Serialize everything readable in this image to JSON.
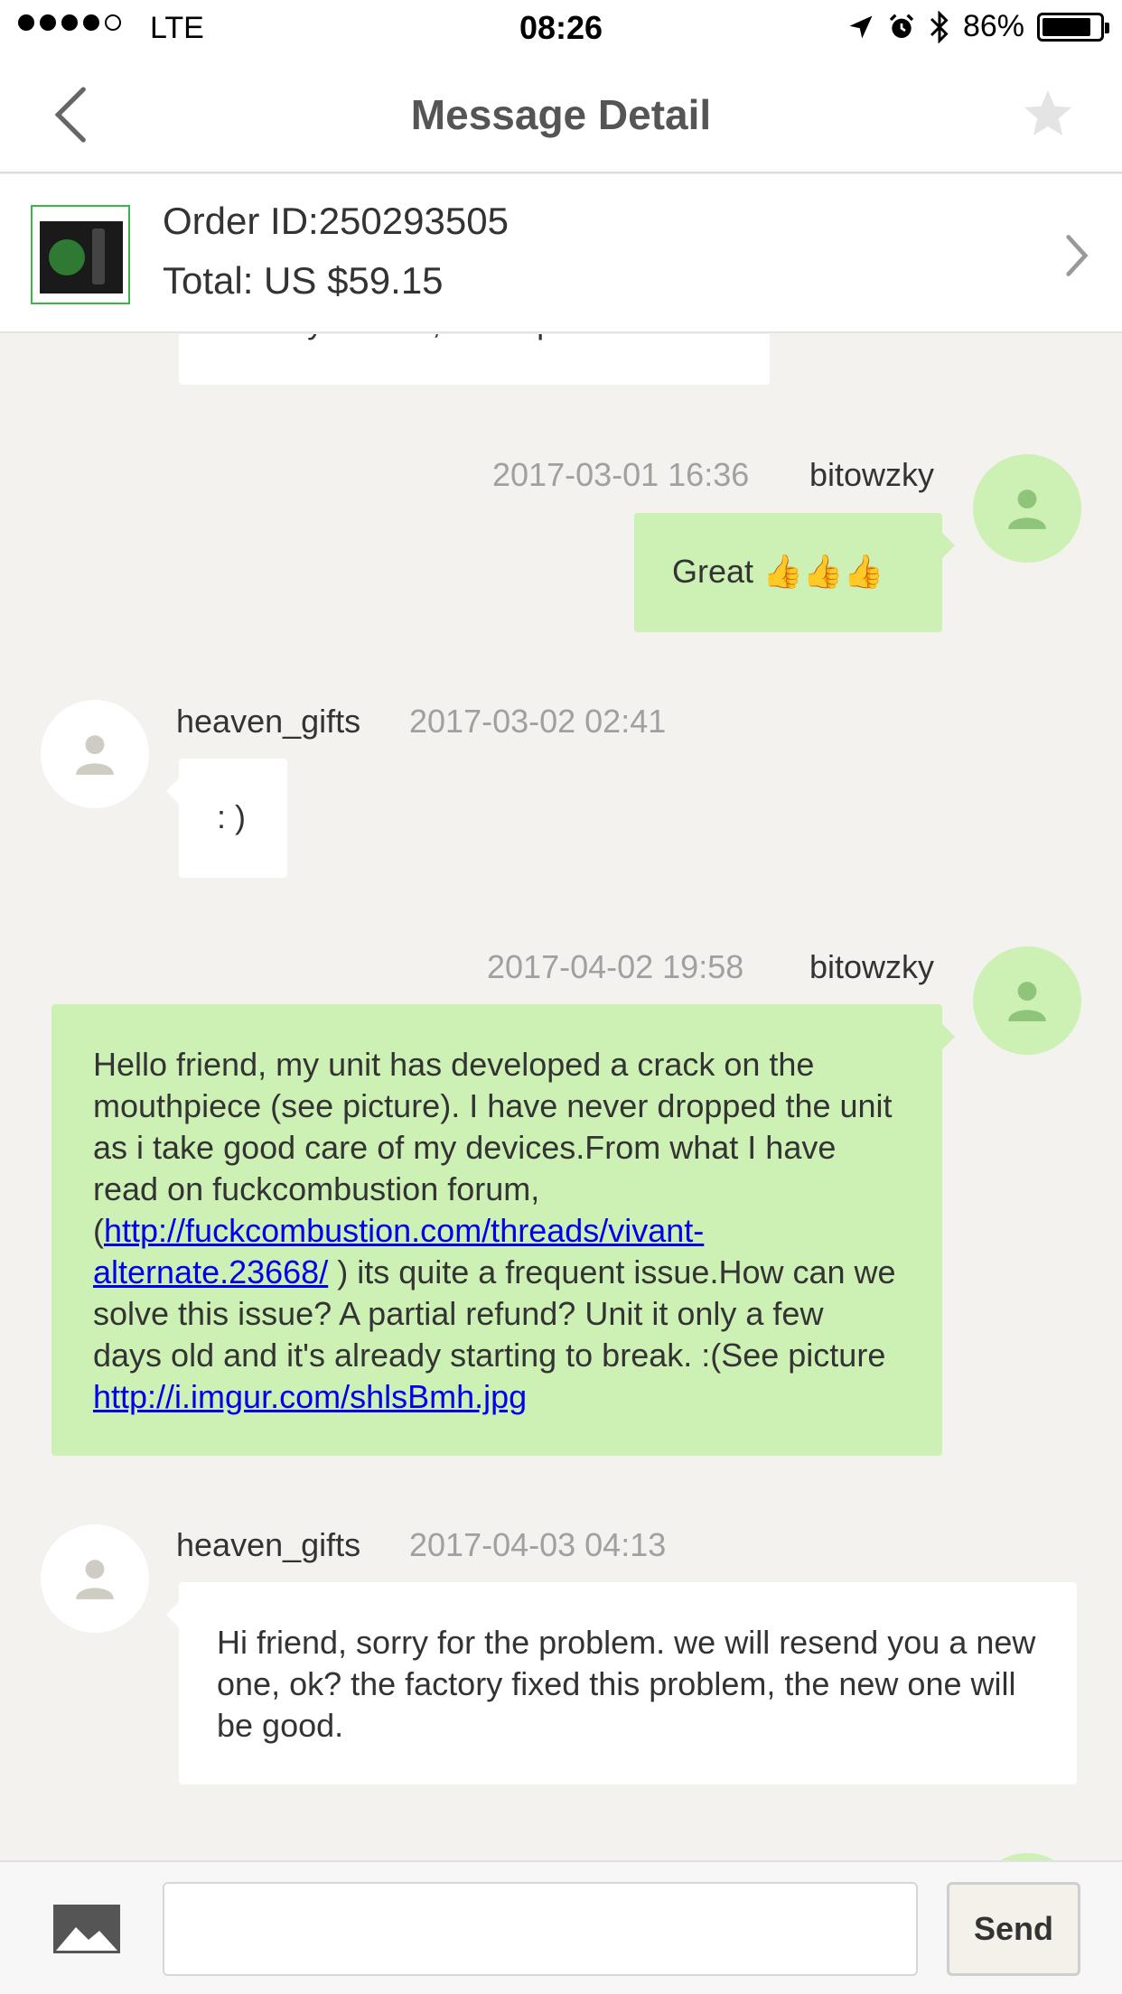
{
  "status_bar": {
    "carrier": "LTE",
    "time": "08:26",
    "battery": "86%",
    "battery_level": 0.86
  },
  "nav": {
    "title": "Message Detail"
  },
  "order": {
    "id_text": "Order ID:250293505",
    "total_text": "Total:  US $59.15"
  },
  "messages": [
    {
      "sender": "",
      "time": "",
      "text": "already arrived,will ship tomorrow"
    },
    {
      "sender": "bitowzky",
      "time": "2017-03-01 16:36",
      "text": "Great 👍👍👍"
    },
    {
      "sender": "heaven_gifts",
      "time": "2017-03-02 02:41",
      "text": ": )"
    },
    {
      "sender": "bitowzky",
      "time": "2017-04-02 19:58",
      "text_part1": "Hello friend, my unit has developed a crack on the mouthpiece (see picture). I have never dropped the unit as i take good care of my devices.From what I have read on fuckcombustion forum, (",
      "link1": "http://fuckcombustion.com/threads/vivant-alternate.23668/",
      "text_part2": " ) its quite a frequent issue.How can we solve this issue? A partial refund? Unit it only a few days old and it's already starting to break. :(See picture ",
      "link2": "http://i.imgur.com/shlsBmh.jpg"
    },
    {
      "sender": "heaven_gifts",
      "time": "2017-04-03 04:13",
      "text": "Hi friend, sorry for the  problem. we will resend you a new one, ok? the factory fixed this problem, the new one will be good."
    }
  ],
  "input_bar": {
    "placeholder": "",
    "send_label": "Send"
  },
  "icons": {
    "back": "chevron-left-icon",
    "star": "star-icon",
    "chevron": "chevron-right-icon",
    "image": "image-icon",
    "avatar": "person-icon"
  },
  "colors": {
    "my_bubble": "#cdf0b4",
    "other_bubble": "#ffffff",
    "chat_background": "#f3f2ee",
    "link": "#0000ee"
  }
}
